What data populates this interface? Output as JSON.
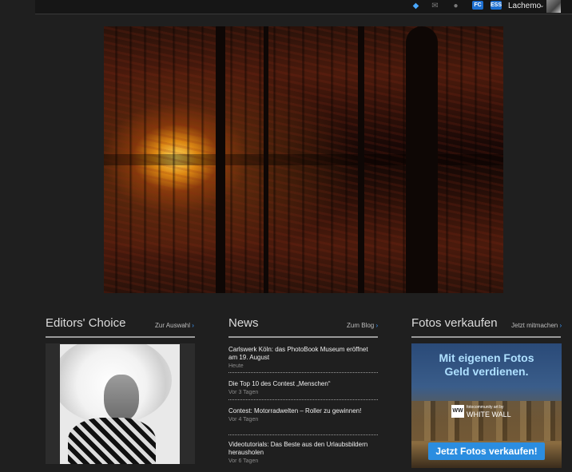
{
  "topbar": {
    "icons": [
      "diamond-icon",
      "mail-icon",
      "chat-icon"
    ],
    "badge1": "FC",
    "badge2": "ESS",
    "username": "Lachemo"
  },
  "editors_choice": {
    "title": "Editors' Choice",
    "link": "Zur Auswahl"
  },
  "news": {
    "title": "News",
    "link": "Zum Blog",
    "items": [
      {
        "headline": "Carlswerk Köln: das PhotoBook Museum eröffnet am 19. August",
        "date": "Heute"
      },
      {
        "headline": "Die Top 10 des Contest „Menschen“",
        "date": "Vor 3 Tagen"
      },
      {
        "headline": "Contest: Motorradwelten – Roller zu gewinnen!",
        "date": "Vor 4 Tagen"
      },
      {
        "headline": "Videotutorials: Das Beste aus den Urlaubsbildern herausholen",
        "date": "Vor 6 Tagen"
      }
    ]
  },
  "sell": {
    "title": "Fotos verkaufen",
    "link": "Jetzt mitmachen",
    "ad_line1": "Mit eigenen Fotos",
    "ad_line2": "Geld verdienen.",
    "brand_logo": "WW",
    "brand_small": "fotocommunity art by",
    "brand_big": "WHITE WALL",
    "cta": "Jetzt Fotos verkaufen!"
  },
  "colors": {
    "background": "#1f1f1f",
    "accent": "#3d9bff",
    "cta": "#2b8de0"
  }
}
